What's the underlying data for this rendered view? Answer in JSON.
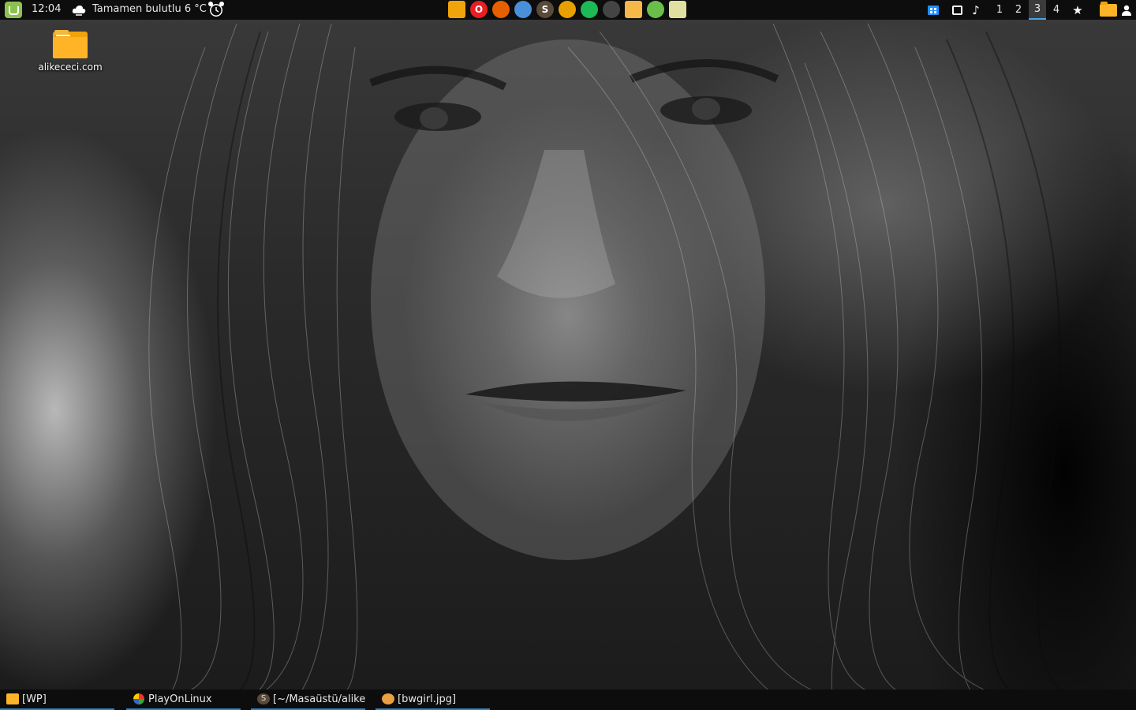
{
  "top_panel": {
    "clock": "12:04",
    "weather": "Tamamen bulutlu 6 °C",
    "launchers": [
      {
        "name": "files-launcher-icon",
        "color": "#f0a30a",
        "glyph": "",
        "square": true
      },
      {
        "name": "opera-launcher-icon",
        "color": "#e81e24",
        "glyph": "O",
        "square": false
      },
      {
        "name": "firefox-launcher-icon",
        "color": "#e66000",
        "glyph": "",
        "square": false
      },
      {
        "name": "chromium-launcher-icon",
        "color": "#4a90d9",
        "glyph": "",
        "square": false
      },
      {
        "name": "sublime-launcher-icon",
        "color": "#5a4a3a",
        "glyph": "S",
        "square": false
      },
      {
        "name": "app-launcher-icon",
        "color": "#e8a000",
        "glyph": "",
        "square": false
      },
      {
        "name": "spotify-launcher-icon",
        "color": "#1db954",
        "glyph": "",
        "square": false
      },
      {
        "name": "playonlinux-launcher-icon",
        "color": "#444444",
        "glyph": "",
        "square": false
      },
      {
        "name": "notes-launcher-icon",
        "color": "#f7b84a",
        "glyph": "",
        "square": true
      },
      {
        "name": "diskcleaner-launcher-icon",
        "color": "#6abf4b",
        "glyph": "",
        "square": false
      },
      {
        "name": "settings-launcher-icon",
        "color": "#e0e0a0",
        "glyph": "",
        "square": true
      }
    ],
    "workspaces": [
      "1",
      "2",
      "3",
      "4"
    ],
    "active_workspace": "3"
  },
  "desktop": {
    "folder_label": "alikececi.com"
  },
  "taskbar": {
    "items": [
      {
        "label": "[WP]"
      },
      {
        "label": "PlayOnLinux"
      },
      {
        "label": "[~/Masaüstü/alike..."
      },
      {
        "label": "[bwgirl.jpg]"
      }
    ]
  },
  "colors": {
    "panel_bg": "#0d0d0d",
    "accent": "#4aa3df",
    "folder": "#ffb428",
    "mint": "#8cc152"
  }
}
